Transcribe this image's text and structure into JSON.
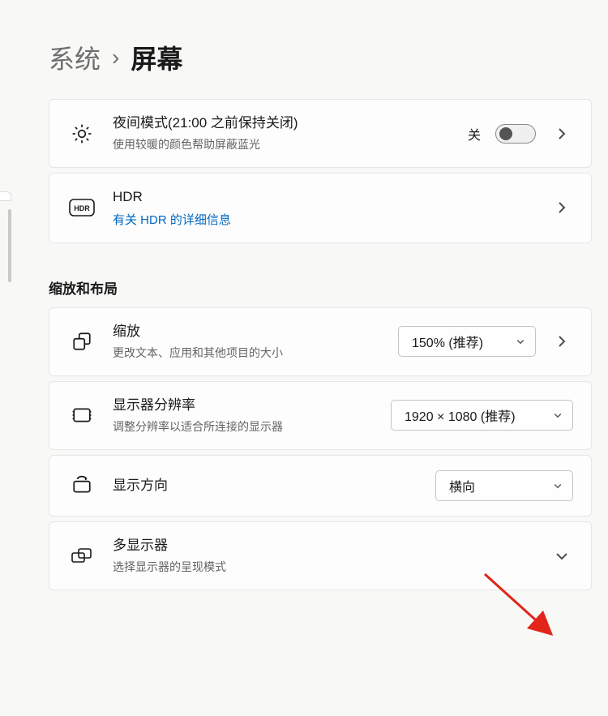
{
  "breadcrumb": {
    "parent": "系统",
    "current": "屏幕"
  },
  "night_light": {
    "title": "夜间模式(21:00 之前保持关闭)",
    "subtitle": "使用较暖的颜色帮助屏蔽蓝光",
    "state_label": "关",
    "toggle_on": false
  },
  "hdr": {
    "title": "HDR",
    "link_text": "有关 HDR 的详细信息"
  },
  "section_scale_layout": "缩放和布局",
  "scale": {
    "title": "缩放",
    "subtitle": "更改文本、应用和其他项目的大小",
    "dropdown_value": "150% (推荐)"
  },
  "resolution": {
    "title": "显示器分辨率",
    "subtitle": "调整分辨率以适合所连接的显示器",
    "dropdown_value": "1920 × 1080 (推荐)"
  },
  "orientation": {
    "title": "显示方向",
    "dropdown_value": "横向"
  },
  "multi_display": {
    "title": "多显示器",
    "subtitle": "选择显示器的呈现模式"
  }
}
